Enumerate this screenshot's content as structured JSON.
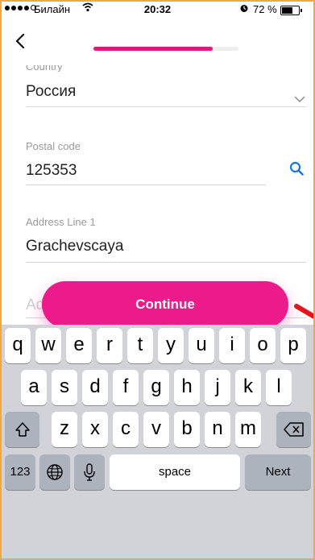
{
  "status_bar": {
    "carrier": "Билайн",
    "time": "20:32",
    "battery_percent_text": "72 %",
    "battery_level": 0.72
  },
  "nav": {
    "progress_fraction": 0.82
  },
  "form": {
    "country": {
      "label": "Country",
      "value": "Россия"
    },
    "postal_code": {
      "label": "Postal code",
      "value": "125353"
    },
    "address_line_1": {
      "label": "Address Line 1",
      "value": "Grachevscaya"
    },
    "address_line_2": {
      "placeholder": "Address Line 2"
    }
  },
  "continue_button": {
    "label": "Continue"
  },
  "accent_color": "#ec1a8a",
  "keyboard": {
    "row1": [
      "q",
      "w",
      "e",
      "r",
      "t",
      "y",
      "u",
      "i",
      "o",
      "p"
    ],
    "row2": [
      "a",
      "s",
      "d",
      "f",
      "g",
      "h",
      "j",
      "k",
      "l"
    ],
    "row3": [
      "z",
      "x",
      "c",
      "v",
      "b",
      "n",
      "m"
    ],
    "numbers_key": "123",
    "space_key": "space",
    "next_key": "Next"
  }
}
